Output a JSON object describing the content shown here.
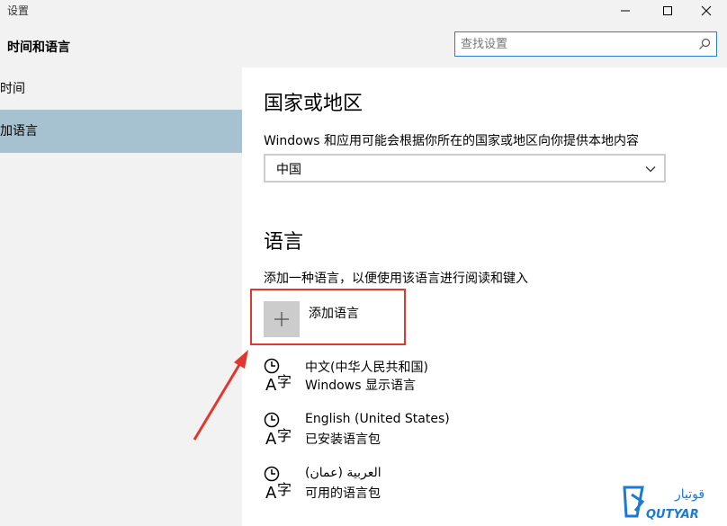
{
  "window": {
    "title": "设置",
    "min_icon": "minimize-icon",
    "max_icon": "maximize-icon",
    "close_icon": "close-icon"
  },
  "header": {
    "page_title": "时间和语言",
    "search_placeholder": "查找设置"
  },
  "sidebar": {
    "items": [
      {
        "label": "时间",
        "active": false
      },
      {
        "label": "加语言",
        "active": true
      }
    ]
  },
  "region": {
    "heading": "国家或地区",
    "description": "Windows 和应用可能会根据你所在的国家或地区向你提供本地内容",
    "selected_value": "中国"
  },
  "language": {
    "heading": "语言",
    "description": "添加一种语言，以便使用该语言进行阅读和键入",
    "add_label": "添加语言",
    "items": [
      {
        "name": "中文(中华人民共和国)",
        "status": "Windows 显示语言"
      },
      {
        "name": "English (United States)",
        "status": "已安装语言包"
      },
      {
        "name": "العربية (عمان)",
        "status": "可用的语言包"
      }
    ]
  },
  "watermark": {
    "text": "QUTYAR",
    "arabic": "قوتيار"
  },
  "colors": {
    "accent": "#2b7fd0",
    "sidebar_active": "#a6c2d1",
    "highlight": "#e2372f"
  }
}
